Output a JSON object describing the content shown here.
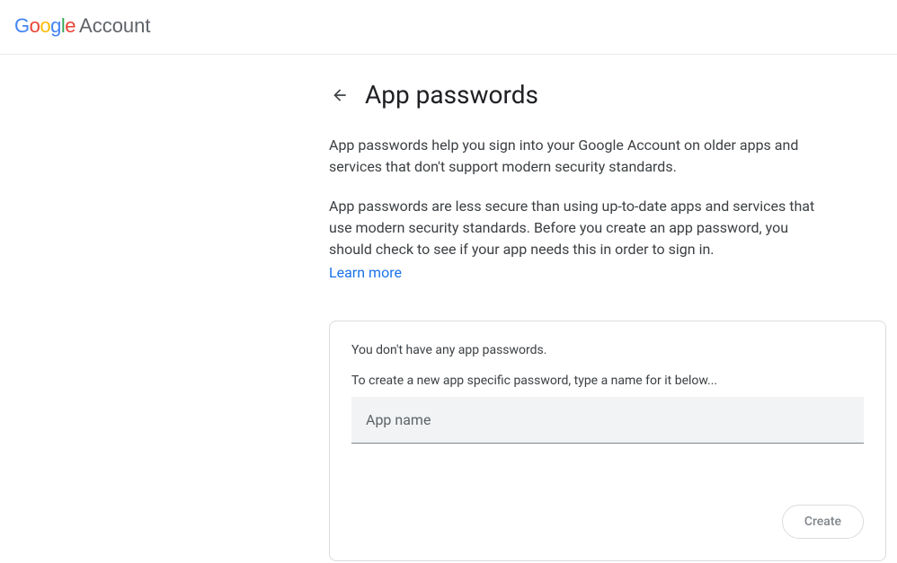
{
  "header": {
    "logo_account": "Account"
  },
  "main": {
    "title": "App passwords",
    "description1": "App passwords help you sign into your Google Account on older apps and services that don't support modern security standards.",
    "description2": "App passwords are less secure than using up-to-date apps and services that use modern security standards. Before you create an app password, you should check to see if your app needs this in order to sign in.",
    "learn_more": "Learn more"
  },
  "card": {
    "empty_text": "You don't have any app passwords.",
    "instruction": "To create a new app specific password, type a name for it below...",
    "input_placeholder": "App name",
    "create_button": "Create"
  }
}
